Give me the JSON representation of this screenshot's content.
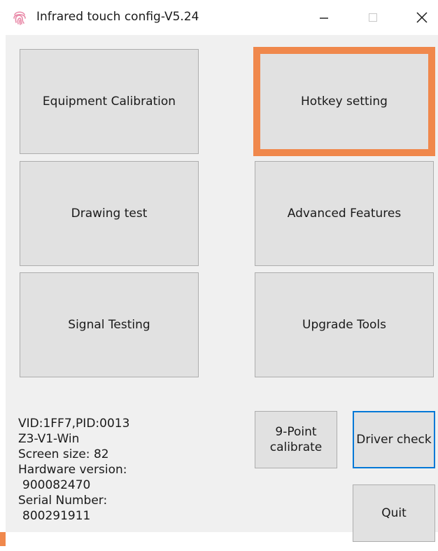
{
  "window": {
    "title": "Infrared touch config-V5.24"
  },
  "buttons": {
    "equipment_calibration": "Equipment Calibration",
    "hotkey_setting": "Hotkey setting",
    "drawing_test": "Drawing test",
    "advanced_features": "Advanced Features",
    "signal_testing": "Signal Testing",
    "upgrade_tools": "Upgrade Tools",
    "nine_point_line1": "9-Point",
    "nine_point_line2": "calibrate",
    "driver_check": "Driver check",
    "quit": "Quit"
  },
  "device_info": {
    "vid_pid": "VID:1FF7,PID:0013",
    "model": "Z3-V1-Win",
    "screen_size": "Screen size: 82",
    "hardware_label": "Hardware version:",
    "hardware_value": "900082470",
    "serial_label": "Serial Number:",
    "serial_value": "800291911"
  },
  "colors": {
    "focus_border": "#f0884c",
    "default_border": "#0078d7",
    "button_face": "#e1e1e1",
    "client_bg": "#f0f0f0"
  },
  "icons": {
    "app": "fingerprint-icon",
    "minimize": "minimize-icon",
    "maximize": "maximize-icon",
    "close": "close-icon"
  }
}
